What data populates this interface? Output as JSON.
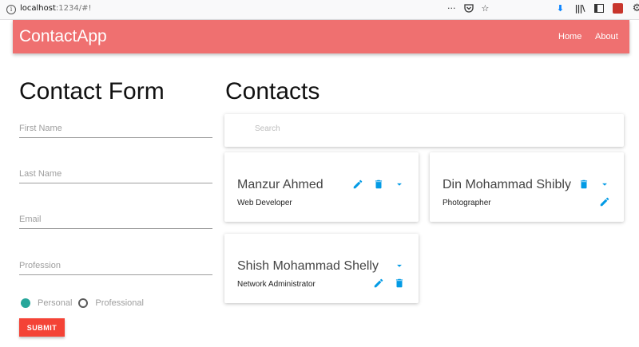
{
  "browser": {
    "url_host": "localhost",
    "url_rest": ":1234/#!",
    "page_actions": "···"
  },
  "navbar": {
    "brand": "ContactApp",
    "links": [
      "Home",
      "About"
    ]
  },
  "form": {
    "title": "Contact Form",
    "fields": [
      {
        "placeholder": "First Name",
        "value": ""
      },
      {
        "placeholder": "Last Name",
        "value": ""
      },
      {
        "placeholder": "Email",
        "value": ""
      },
      {
        "placeholder": "Profession",
        "value": ""
      }
    ],
    "radios": [
      {
        "label": "Personal",
        "selected": true
      },
      {
        "label": "Professional",
        "selected": false
      }
    ],
    "submit_label": "SUBMIT"
  },
  "contacts": {
    "title": "Contacts",
    "search_placeholder": "Search",
    "cards": [
      {
        "name": "Manzur Ahmed",
        "role": "Web Developer"
      },
      {
        "name": "Din Mohammad Shibly",
        "role": "Photographer"
      },
      {
        "name": "Shish Mohammad Shelly",
        "role": "Network Administrator"
      }
    ]
  },
  "colors": {
    "navbar": "#ef7070",
    "accent": "#039be5",
    "radio_on": "#26a69a",
    "submit": "#f44336"
  }
}
